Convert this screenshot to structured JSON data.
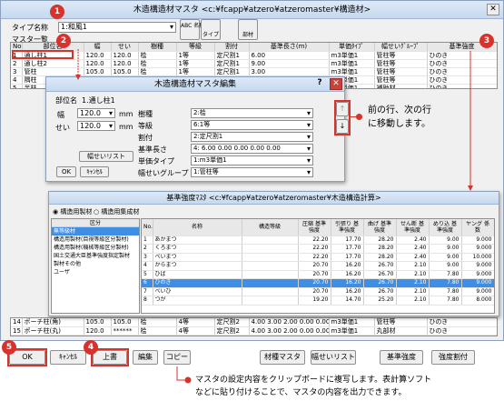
{
  "main": {
    "title": "木造構造材マスタ <c:¥fcapp¥atzero¥atzeromaster¥構造材>",
    "type_label": "タイプ名称",
    "type_value": "1:和風1",
    "master_label": "マスタ一覧",
    "toolbar": [
      "ABC 名称",
      "タイプ",
      "部材"
    ],
    "headers": [
      "No.",
      "部位名",
      "幅",
      "せい",
      "樹種",
      "等級",
      "割付",
      "基準長さ(m)",
      "単価ﾀｲﾌﾟ",
      "幅せいｸﾞﾙｰﾌﾟ",
      "基準強度"
    ],
    "rows": [
      [
        "1",
        "通し柱1",
        "120.0",
        "120.0",
        "桧",
        "1等",
        "定尺割1",
        "6.00",
        "m3単価1",
        "管柱等",
        "ひのき"
      ],
      [
        "2",
        "通し柱2",
        "120.0",
        "120.0",
        "桧",
        "1等",
        "定尺割1",
        "9.00",
        "m3単価1",
        "管柱等",
        "ひのき"
      ],
      [
        "3",
        "管柱",
        "105.0",
        "105.0",
        "桧",
        "1等",
        "定尺割1",
        "3.00",
        "m3単価1",
        "管柱等",
        "ひのき"
      ],
      [
        "4",
        "隅柱",
        "",
        "",
        "",
        "",
        "",
        "",
        "m3単価1",
        "管柱等",
        "ひのき"
      ],
      [
        "5",
        "半柱",
        "",
        "",
        "",
        "",
        "",
        "",
        "m3単価1",
        "補助材",
        "ひのき"
      ]
    ],
    "bottom_rows": [
      [
        "14",
        "ポーチ柱(角)",
        "105.0",
        "105.0",
        "桧",
        "4等",
        "定尺割2",
        "4.00 3.00 2.00 0.00 0.00",
        "m3単価1",
        "管柱等",
        "ひのき"
      ],
      [
        "15",
        "ポーチ柱(丸)",
        "120.0",
        "******",
        "桧",
        "4等",
        "定尺割2",
        "4.00 3.00 2.00 0.00 0.00",
        "m3単価1",
        "丸部材",
        "ひのき"
      ]
    ],
    "buttons": {
      "ok": "OK",
      "cancel": "ｷｬﾝｾﾙ",
      "overwrite": "上書",
      "edit": "編集",
      "copy": "コピー",
      "material": "材種マスタ",
      "width": "幅せいリスト",
      "strength": "基準強度",
      "strength_alloc": "強度割付"
    }
  },
  "edit": {
    "title": "木造構造材マスタ編集",
    "part_label": "部位名",
    "part_value": "1.通し柱1",
    "width_label": "幅",
    "width_value": "120.0",
    "height_label": "せい",
    "height_value": "120.0",
    "unit": "mm",
    "wlist": "幅せいリスト",
    "ok": "OK",
    "cancel": "ｷｬﾝｾﾙ",
    "fields": [
      {
        "label": "樹種",
        "value": "2:桧"
      },
      {
        "label": "等級",
        "value": "6:1等"
      },
      {
        "label": "割付",
        "value": "2:定尺割1"
      },
      {
        "label": "基準長さ",
        "value": "4:  6.00  0.00  0.00  0.00  0.00"
      },
      {
        "label": "単価タイプ",
        "value": "1:m3単価1"
      },
      {
        "label": "幅せいグループ",
        "value": "1:管柱等"
      }
    ]
  },
  "strength": {
    "title": "基準強度ﾏｽﾀ <c:¥fcapp¥atzero¥atzeromaster¥木造構造計算>",
    "radio1": "構造用製材",
    "radio2": "構造用集成材",
    "category_header": "区分",
    "categories": [
      "無等級材",
      "構造用製材(目視等級区分製材)",
      "構造用製材(機械等級区分製材)",
      "国土交通大臣基準強度指定製材",
      "製材その他",
      "ユーザ"
    ],
    "headers": [
      "No.",
      "名称",
      "構造等級",
      "圧縮 基準強度",
      "引張り 基準強度",
      "曲げ 基準強度",
      "せん断 基準強度",
      "めり込 基準強度",
      "ヤング 係数"
    ],
    "rows": [
      [
        "1",
        "あかまつ",
        "",
        "22.20",
        "17.70",
        "28.20",
        "2.40",
        "9.00",
        "9.000"
      ],
      [
        "2",
        "くろまつ",
        "",
        "22.20",
        "17.70",
        "28.20",
        "2.40",
        "9.00",
        "9.000"
      ],
      [
        "3",
        "べいまつ",
        "",
        "22.20",
        "17.70",
        "28.20",
        "2.40",
        "9.00",
        "10.000"
      ],
      [
        "4",
        "からまつ",
        "",
        "20.70",
        "16.20",
        "26.70",
        "2.10",
        "9.00",
        "9.000"
      ],
      [
        "5",
        "ひば",
        "",
        "20.70",
        "16.20",
        "26.70",
        "2.10",
        "7.80",
        "9.000"
      ],
      [
        "6",
        "ひのき",
        "",
        "20.70",
        "16.20",
        "26.70",
        "2.10",
        "7.80",
        "9.000"
      ],
      [
        "7",
        "べいひ",
        "",
        "20.70",
        "16.20",
        "26.70",
        "2.10",
        "7.80",
        "9.000"
      ],
      [
        "8",
        "つが",
        "",
        "19.20",
        "14.70",
        "25.20",
        "2.10",
        "7.80",
        "8.000"
      ]
    ]
  },
  "badges": [
    "1",
    "2",
    "3",
    "4",
    "5"
  ],
  "annotations": {
    "nav": "前の行、次の行\nに移動します。",
    "copy": "マスタの設定内容をクリップボードに複写します。表計算ソフト\nなどに貼り付けることで、マスタの内容を出力できます。"
  },
  "colors": {
    "badge": "#d7322c",
    "selection": "#3e8ee6",
    "title_bar": "#c6d9ef"
  }
}
